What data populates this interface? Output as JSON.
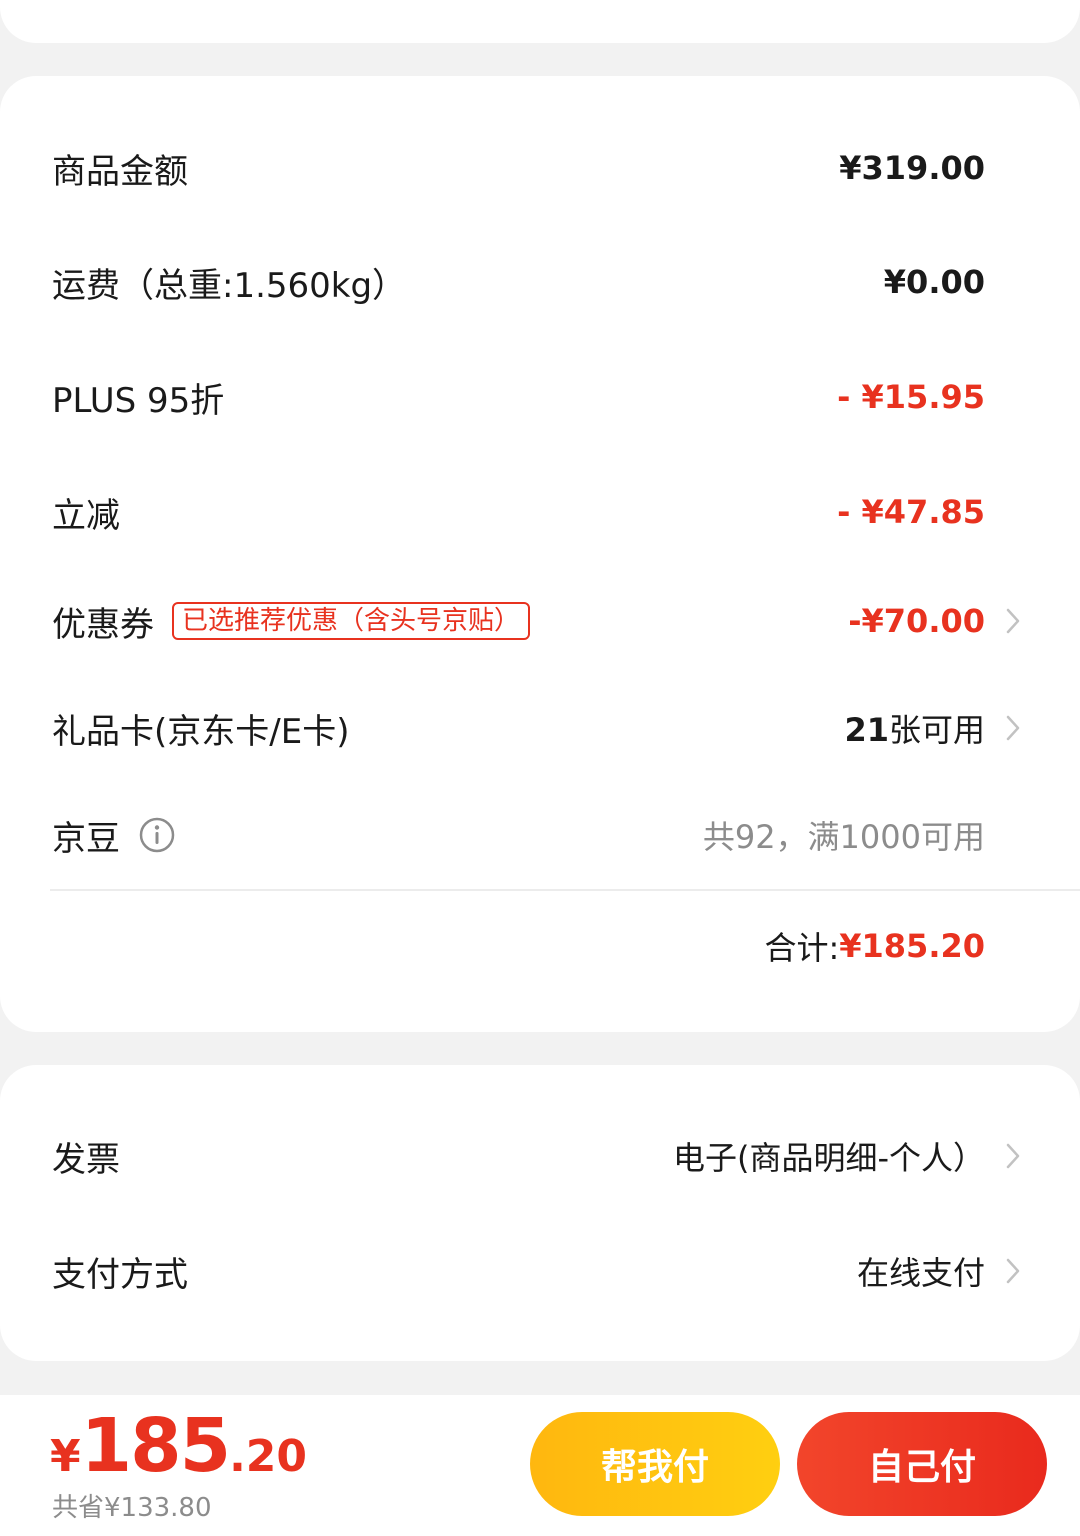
{
  "price_details": {
    "rows": [
      {
        "label": "商品金额",
        "value": "¥319.00"
      },
      {
        "label": "运费（总重:1.560kg）",
        "value": "¥0.00"
      },
      {
        "label": "PLUS 95折",
        "value": "- ¥15.95"
      },
      {
        "label": "立减",
        "value": "- ¥47.85"
      },
      {
        "label": "优惠券",
        "tag": "已选推荐优惠（含头号京贴）",
        "value": "-¥70.00"
      },
      {
        "label": "礼品卡(京东卡/E卡)",
        "value_bold": "21",
        "value_rest": "张可用"
      },
      {
        "label": "京豆",
        "value": "共92，满1000可用"
      }
    ],
    "total_label": "合计: ",
    "total_value": "¥185.20"
  },
  "options": {
    "invoice_label": "发票",
    "invoice_value": "电子(商品明细-个人）",
    "payment_label": "支付方式",
    "payment_value": "在线支付"
  },
  "bottom_bar": {
    "currency": "¥",
    "price_int": "185",
    "price_dec": ".20",
    "saved": "共省¥133.80",
    "help_pay_label": "帮我付",
    "self_pay_label": "自己付"
  },
  "colors": {
    "accent_red": "#e8321f",
    "accent_yellow": "#ffc20e",
    "muted_gray": "#8c8c8c"
  }
}
